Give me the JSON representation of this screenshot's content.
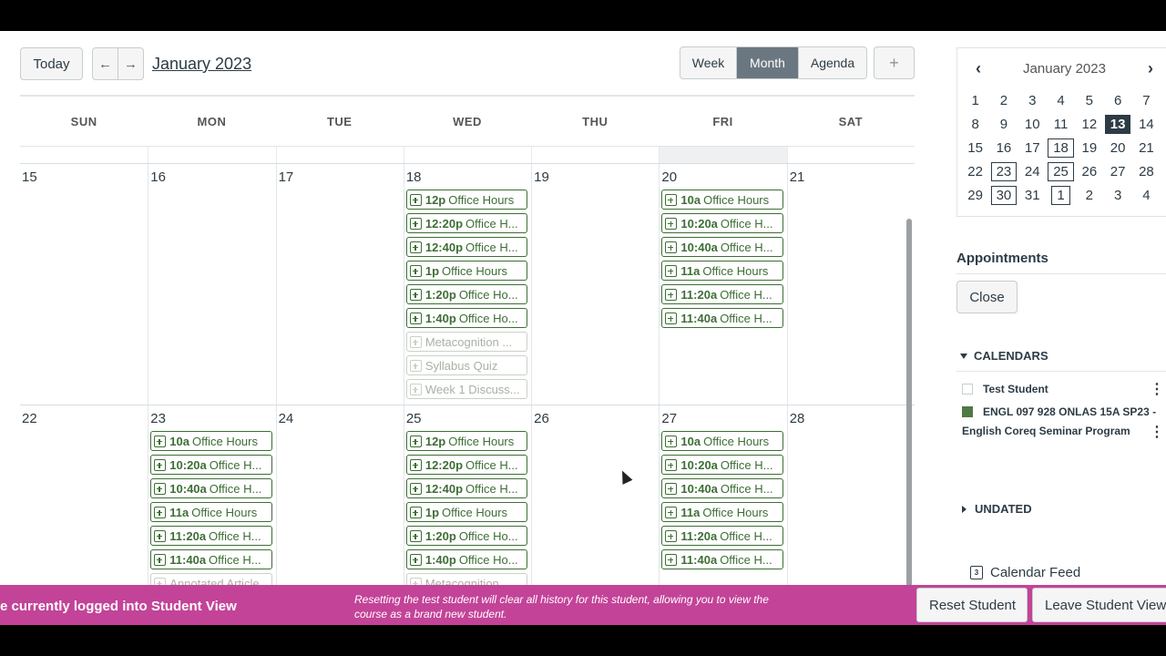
{
  "toolbar": {
    "today_label": "Today",
    "prev_arrow": "←",
    "next_arrow": "→",
    "month_title": "January 2023",
    "views": [
      "Week",
      "Month",
      "Agenda"
    ],
    "active_view": "Month",
    "add_label": "+"
  },
  "days_of_week": [
    "SUN",
    "MON",
    "TUE",
    "WED",
    "THU",
    "FRI",
    "SAT"
  ],
  "weeks": [
    {
      "days": [
        {
          "num": "15",
          "events": []
        },
        {
          "num": "16",
          "events": []
        },
        {
          "num": "17",
          "events": []
        },
        {
          "num": "18",
          "events": [
            {
              "time": "12p",
              "title": "Office Hours",
              "faded": false
            },
            {
              "time": "12:20p",
              "title": "Office H...",
              "faded": false
            },
            {
              "time": "12:40p",
              "title": "Office H...",
              "faded": false
            },
            {
              "time": "1p",
              "title": "Office Hours",
              "faded": false
            },
            {
              "time": "1:20p",
              "title": "Office Ho...",
              "faded": false
            },
            {
              "time": "1:40p",
              "title": "Office Ho...",
              "faded": false
            },
            {
              "time": "",
              "title": "Metacognition ...",
              "faded": true
            },
            {
              "time": "",
              "title": "Syllabus Quiz",
              "faded": true
            },
            {
              "time": "",
              "title": "Week 1 Discuss...",
              "faded": true
            }
          ]
        },
        {
          "num": "19",
          "events": []
        },
        {
          "num": "20",
          "events": [
            {
              "time": "10a",
              "title": "Office Hours",
              "faded": false
            },
            {
              "time": "10:20a",
              "title": "Office H...",
              "faded": false
            },
            {
              "time": "10:40a",
              "title": "Office H...",
              "faded": false
            },
            {
              "time": "11a",
              "title": "Office Hours",
              "faded": false
            },
            {
              "time": "11:20a",
              "title": "Office H...",
              "faded": false
            },
            {
              "time": "11:40a",
              "title": "Office H...",
              "faded": false
            }
          ]
        },
        {
          "num": "21",
          "events": []
        }
      ]
    },
    {
      "days": [
        {
          "num": "22",
          "events": []
        },
        {
          "num": "23",
          "events": [
            {
              "time": "10a",
              "title": "Office Hours",
              "faded": false
            },
            {
              "time": "10:20a",
              "title": "Office H...",
              "faded": false
            },
            {
              "time": "10:40a",
              "title": "Office H...",
              "faded": false
            },
            {
              "time": "11a",
              "title": "Office Hours",
              "faded": false
            },
            {
              "time": "11:20a",
              "title": "Office H...",
              "faded": false
            },
            {
              "time": "11:40a",
              "title": "Office H...",
              "faded": false
            },
            {
              "time": "",
              "title": "Annotated Article...",
              "faded": true
            }
          ]
        },
        {
          "num": "24",
          "events": []
        },
        {
          "num": "25",
          "events": [
            {
              "time": "12p",
              "title": "Office Hours",
              "faded": false
            },
            {
              "time": "12:20p",
              "title": "Office H...",
              "faded": false
            },
            {
              "time": "12:40p",
              "title": "Office H...",
              "faded": false
            },
            {
              "time": "1p",
              "title": "Office Hours",
              "faded": false
            },
            {
              "time": "1:20p",
              "title": "Office Ho...",
              "faded": false
            },
            {
              "time": "1:40p",
              "title": "Office Ho...",
              "faded": false
            },
            {
              "time": "",
              "title": "Metacognition ...",
              "faded": true
            }
          ]
        },
        {
          "num": "26",
          "events": []
        },
        {
          "num": "27",
          "events": [
            {
              "time": "10a",
              "title": "Office Hours",
              "faded": false
            },
            {
              "time": "10:20a",
              "title": "Office H...",
              "faded": false
            },
            {
              "time": "10:40a",
              "title": "Office H...",
              "faded": false
            },
            {
              "time": "11a",
              "title": "Office Hours",
              "faded": false
            },
            {
              "time": "11:20a",
              "title": "Office H...",
              "faded": false
            },
            {
              "time": "11:40a",
              "title": "Office H...",
              "faded": false
            }
          ]
        },
        {
          "num": "28",
          "events": []
        }
      ]
    }
  ],
  "mini_calendar": {
    "title": "January 2023",
    "prev": "‹",
    "next": "›",
    "rows": [
      [
        "1",
        "2",
        "3",
        "4",
        "5",
        "6",
        "7"
      ],
      [
        "8",
        "9",
        "10",
        "11",
        "12",
        "13",
        "14"
      ],
      [
        "15",
        "16",
        "17",
        "18",
        "19",
        "20",
        "21"
      ],
      [
        "22",
        "23",
        "24",
        "25",
        "26",
        "27",
        "28"
      ],
      [
        "29",
        "30",
        "31",
        "1",
        "2",
        "3",
        "4"
      ]
    ],
    "today": "13",
    "boxed": [
      [
        2,
        3
      ],
      [
        3,
        1
      ],
      [
        3,
        3
      ],
      [
        4,
        1
      ],
      [
        4,
        3
      ]
    ]
  },
  "sidebar": {
    "appointments_title": "Appointments",
    "close_label": "Close",
    "calendars_title": "CALENDARS",
    "calendars": [
      {
        "name": "Test Student",
        "color": "#ffffff"
      },
      {
        "name": "ENGL 097 928 ONLAS 15A SP23 -",
        "color": "#4e7a43"
      }
    ],
    "calendar_sub": "English Coreq Seminar Program",
    "kebab": "⋮",
    "undated_title": "UNDATED",
    "feed_label": "Calendar Feed",
    "feed_icon_text": "3"
  },
  "student_bar": {
    "status_text": "e currently logged into Student View",
    "note": "Resetting the test student will clear all history for this student, allowing you to view the course as a brand new student.",
    "reset_label": "Reset Student",
    "leave_label": "Leave Student View"
  },
  "colors": {
    "event_green": "#3d6e35",
    "student_bar": "#c34398",
    "active_view": "#6b7780"
  }
}
